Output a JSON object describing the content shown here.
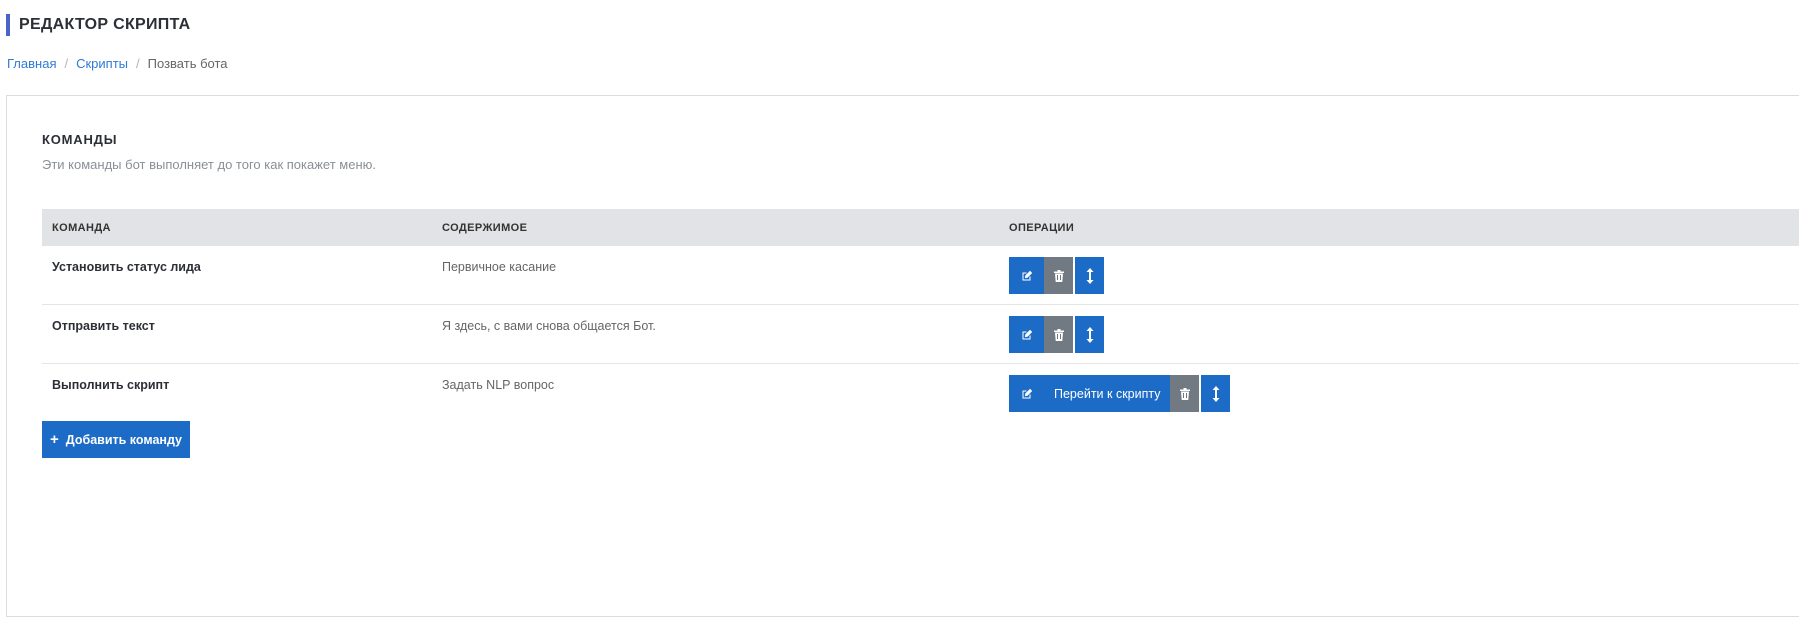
{
  "page": {
    "title": "РЕДАКТОР СКРИПТА",
    "accent_color": "#4a63c8"
  },
  "breadcrumb": {
    "items": [
      "Главная",
      "Скрипты",
      "Позвать бота"
    ],
    "separator": "/"
  },
  "section": {
    "title": "КОМАНДЫ",
    "description": "Эти команды бот выполняет до того как покажет меню."
  },
  "table": {
    "headers": [
      "КОМАНДА",
      "СОДЕРЖИМОЕ",
      "ОПЕРАЦИИ"
    ],
    "rows": [
      {
        "command": "Установить статус лида",
        "content": "Первичное касание",
        "operations": [
          "edit-icon",
          "trash-icon",
          "move-vertical-icon"
        ]
      },
      {
        "command": "Отправить текст",
        "content": "Я здесь, с вами снова общается Бот.",
        "operations": [
          "edit-icon",
          "trash-icon",
          "move-vertical-icon"
        ]
      },
      {
        "command": "Выполнить скрипт",
        "content": "Задать NLP вопрос",
        "operations": [
          "edit-icon",
          "go-to-script",
          "trash-icon",
          "move-vertical-icon"
        ],
        "go_to_label": "Перейти к скрипту"
      }
    ]
  },
  "actions": {
    "add_label": "Добавить команду",
    "add_icon": "plus-icon"
  },
  "colors": {
    "primary": "#1c6cc7",
    "secondary": "#717983",
    "link": "#2f7ad6",
    "header_bg": "#e1e3e6"
  }
}
